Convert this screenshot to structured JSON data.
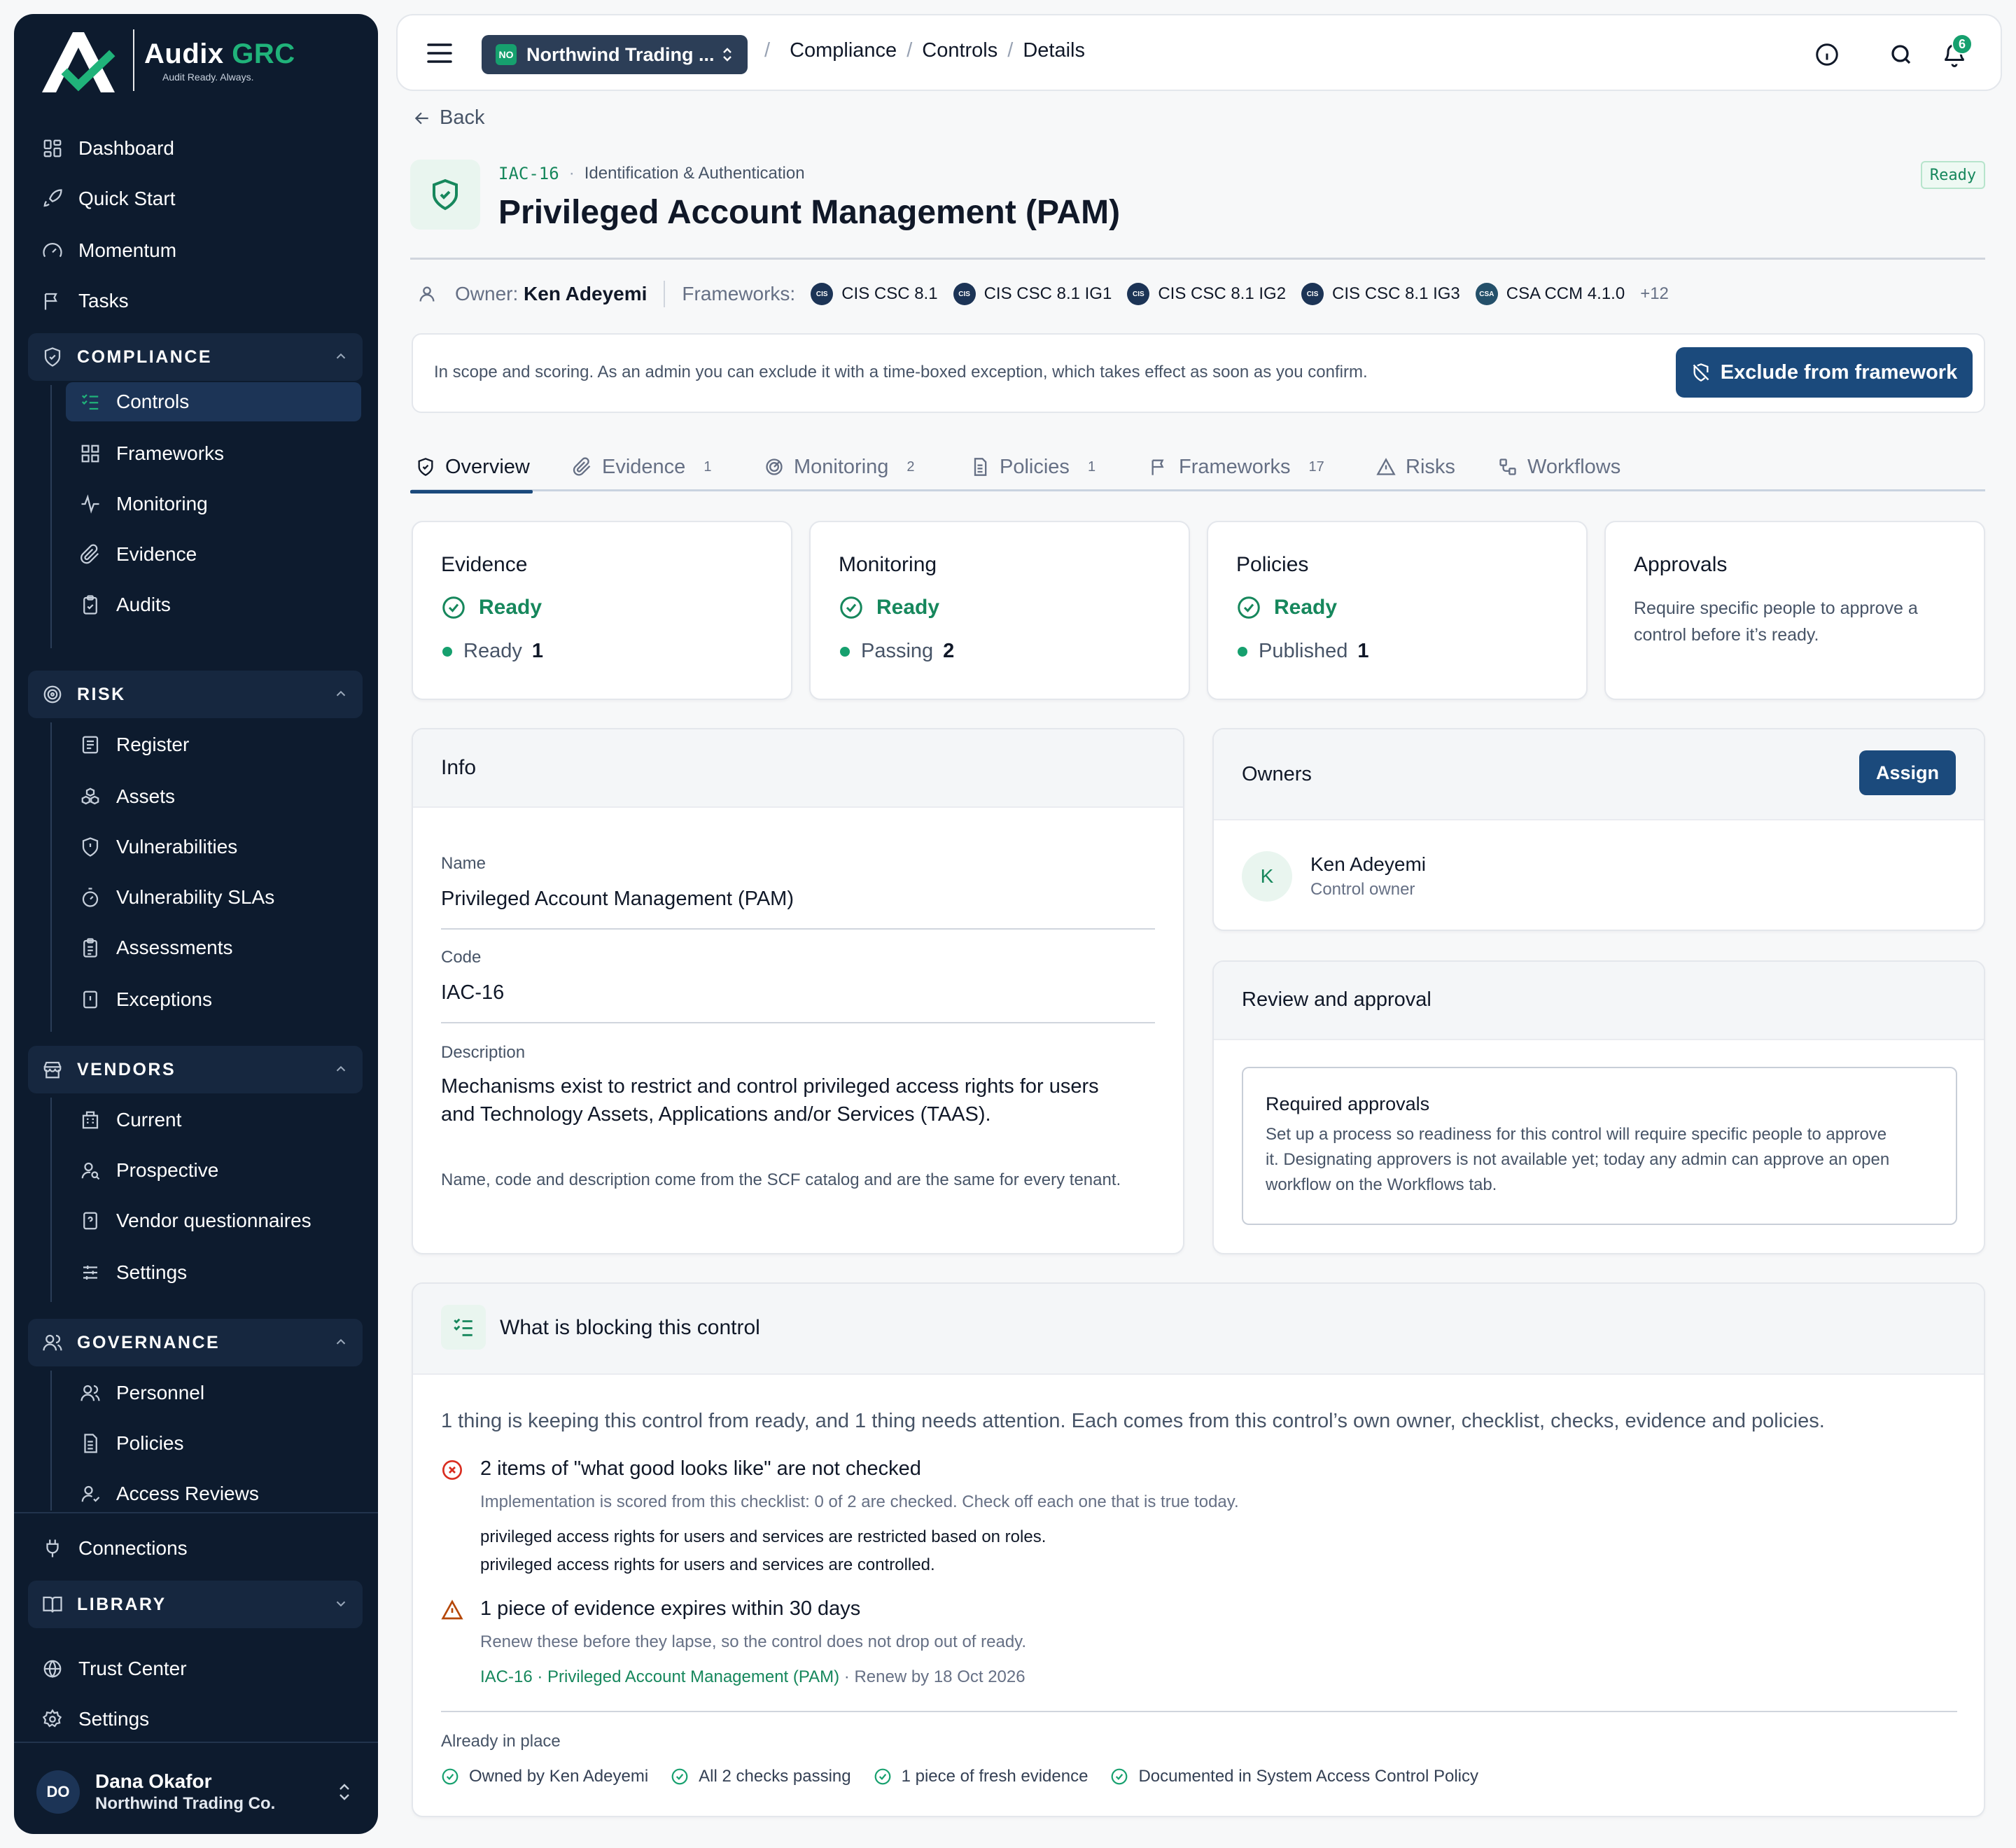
{
  "brand": {
    "name_a": "Audix",
    "name_b": "GRC",
    "tagline": "Audit Ready. Always."
  },
  "sidebar": {
    "top_items": [
      {
        "label": "Dashboard",
        "icon": "dashboard-icon"
      },
      {
        "label": "Quick Start",
        "icon": "rocket-icon"
      },
      {
        "label": "Momentum",
        "icon": "gauge-icon"
      },
      {
        "label": "Tasks",
        "icon": "flag-icon"
      }
    ],
    "compliance": {
      "title": "COMPLIANCE",
      "items": [
        "Controls",
        "Frameworks",
        "Monitoring",
        "Evidence",
        "Audits"
      ]
    },
    "risk": {
      "title": "RISK",
      "items": [
        "Register",
        "Assets",
        "Vulnerabilities",
        "Vulnerability SLAs",
        "Assessments",
        "Exceptions"
      ]
    },
    "vendors": {
      "title": "VENDORS",
      "items": [
        "Current",
        "Prospective",
        "Vendor questionnaires",
        "Settings"
      ]
    },
    "governance": {
      "title": "GOVERNANCE",
      "items": [
        "Personnel",
        "Policies",
        "Access Reviews"
      ]
    },
    "connections": "Connections",
    "library": {
      "title": "LIBRARY"
    },
    "bottom_items": [
      "Trust Center",
      "Settings"
    ],
    "user": {
      "initials": "DO",
      "name": "Dana Okafor",
      "org": "Northwind Trading Co."
    }
  },
  "topbar": {
    "org_badge": "NO",
    "org_name": "Northwind Trading ...",
    "breadcrumbs": [
      "Compliance",
      "Controls",
      "Details"
    ],
    "notifications": "6"
  },
  "control": {
    "back": "Back",
    "code": "IAC-16",
    "domain": "Identification & Authentication",
    "title": "Privileged Account Management (PAM)",
    "status": "Ready",
    "owner_label": "Owner:",
    "owner": "Ken Adeyemi",
    "frameworks_label": "Frameworks:",
    "frameworks": [
      {
        "logo": "CIS",
        "name": "CIS CSC 8.1"
      },
      {
        "logo": "CIS",
        "name": "CIS CSC 8.1 IG1"
      },
      {
        "logo": "CIS",
        "name": "CIS CSC 8.1 IG2"
      },
      {
        "logo": "CIS",
        "name": "CIS CSC 8.1 IG3"
      },
      {
        "logo": "CSA",
        "name": "CSA CCM 4.1.0"
      }
    ],
    "frameworks_more": "+12",
    "notice": "In scope and scoring. As an admin you can exclude it with a time-boxed exception, which takes effect as soon as you confirm.",
    "exclude_button": "Exclude from framework"
  },
  "tabs": [
    {
      "label": "Overview",
      "count": ""
    },
    {
      "label": "Evidence",
      "count": "1"
    },
    {
      "label": "Monitoring",
      "count": "2"
    },
    {
      "label": "Policies",
      "count": "1"
    },
    {
      "label": "Frameworks",
      "count": "17"
    },
    {
      "label": "Risks",
      "count": ""
    },
    {
      "label": "Workflows",
      "count": ""
    }
  ],
  "stats": {
    "evidence": {
      "title": "Evidence",
      "status": "Ready",
      "sub_label": "Ready",
      "sub_count": "1"
    },
    "monitoring": {
      "title": "Monitoring",
      "status": "Ready",
      "sub_label": "Passing",
      "sub_count": "2"
    },
    "policies": {
      "title": "Policies",
      "status": "Ready",
      "sub_label": "Published",
      "sub_count": "1"
    },
    "approvals": {
      "title": "Approvals",
      "desc": "Require specific people to approve a control before it’s ready."
    }
  },
  "info": {
    "title": "Info",
    "name_label": "Name",
    "name": "Privileged Account Management (PAM)",
    "code_label": "Code",
    "code": "IAC-16",
    "desc_label": "Description",
    "desc_line1": "Mechanisms exist to restrict and control privileged access rights for users",
    "desc_line2": "and Technology Assets, Applications and/or Services (TAAS).",
    "note": "Name, code and description come from the SCF catalog and are the same for every tenant."
  },
  "owners": {
    "title": "Owners",
    "assign": "Assign",
    "initial": "K",
    "name": "Ken Adeyemi",
    "role": "Control owner"
  },
  "review": {
    "title": "Review and approval",
    "box_title": "Required approvals",
    "box_line1": "Set up a process so readiness for this control will require specific people to approve",
    "box_line2": "it. Designating approvers is not available yet; today any admin can approve an open",
    "box_line3": "workflow on the Workflows tab."
  },
  "blocking": {
    "title": "What is blocking this control",
    "intro": "1 thing is keeping this control from ready, and 1 thing needs attention. Each comes from this control’s own owner, checklist, checks, evidence and policies.",
    "issue1": {
      "title": "2 items of \"what good looks like\" are not checked",
      "sub": "Implementation is scored from this checklist: 0 of 2 are checked. Check off each one that is true today.",
      "items": [
        "privileged access rights for users and services are restricted based on roles.",
        "privileged access rights for users and services are controlled."
      ]
    },
    "issue2": {
      "title": "1 piece of evidence expires within 30 days",
      "sub": "Renew these before they lapse, so the control does not drop out of ready.",
      "link": "IAC-16 · Privileged Account Management (PAM)",
      "renew": " · Renew by 18 Oct 2026"
    },
    "in_place_label": "Already in place",
    "in_place": [
      "Owned by Ken Adeyemi",
      "All 2 checks passing",
      "1 piece of fresh evidence",
      "Documented in System Access Control Policy"
    ]
  },
  "colors": {
    "sidebar": "#0d1b2e",
    "accent_green": "#16875c",
    "primary_blue": "#1b4a7c",
    "error_red": "#d92d20",
    "warning_amber": "#b54708"
  }
}
